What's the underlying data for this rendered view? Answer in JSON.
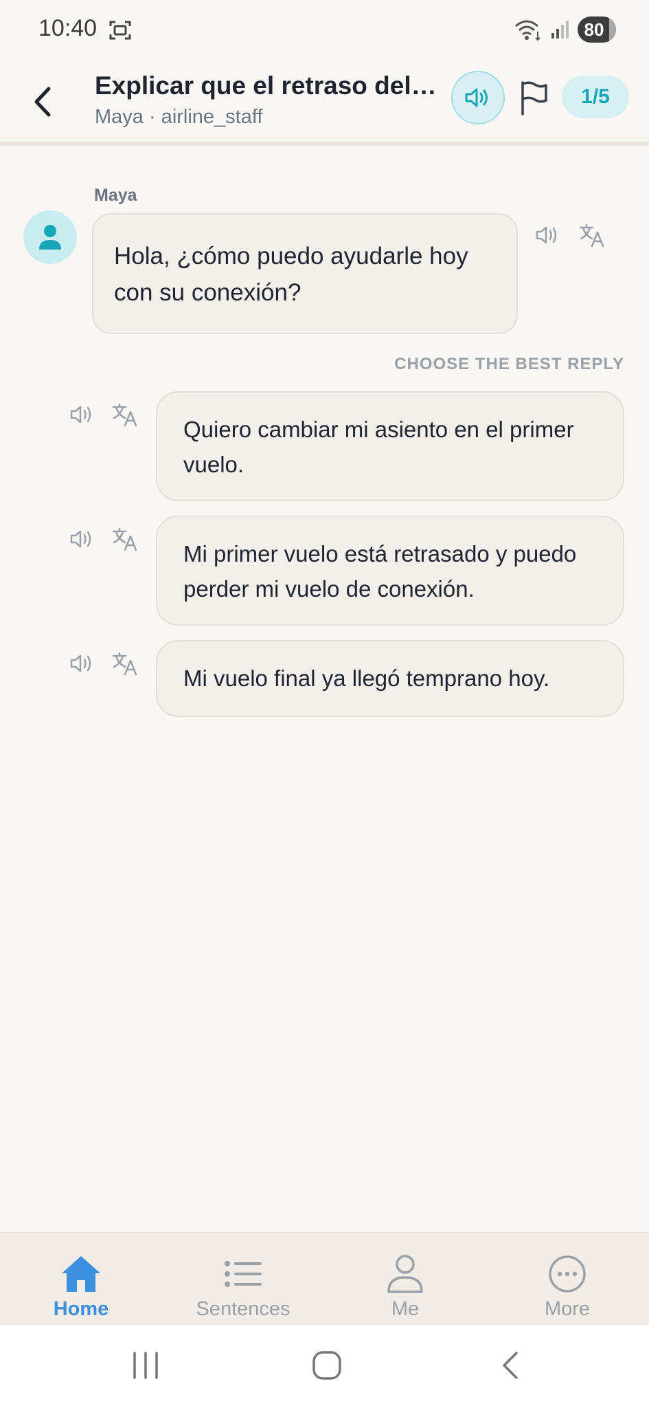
{
  "status_bar": {
    "time": "10:40",
    "battery": "80",
    "icons": [
      "screenshot-icon",
      "wifi-icon",
      "signal-icon",
      "battery-icon"
    ]
  },
  "header": {
    "title": "Explicar que el retraso del p...",
    "subtitle": "Maya · airline_staff",
    "progress": "1/5",
    "accent_color": "#17a5b8"
  },
  "conversation": {
    "speaker": "Maya",
    "message": "Hola, ¿cómo puedo ayudarle hoy con su conexión?"
  },
  "choices": {
    "label": "CHOOSE THE BEST REPLY",
    "options": [
      {
        "text": "Quiero cambiar mi asiento en el primer vuelo."
      },
      {
        "text": "Mi primer vuelo está retrasado y puedo perder mi vuelo de conexión."
      },
      {
        "text": "Mi vuelo final ya llegó temprano hoy."
      }
    ]
  },
  "bottom_nav": {
    "items": [
      {
        "label": "Home",
        "icon": "home-icon",
        "active": true
      },
      {
        "label": "Sentences",
        "icon": "list-icon",
        "active": false
      },
      {
        "label": "Me",
        "icon": "person-icon",
        "active": false
      },
      {
        "label": "More",
        "icon": "more-icon",
        "active": false
      }
    ],
    "active_color": "#3d8fe0"
  },
  "system_nav": {
    "buttons": [
      "recents-button",
      "home-button",
      "back-button"
    ]
  }
}
